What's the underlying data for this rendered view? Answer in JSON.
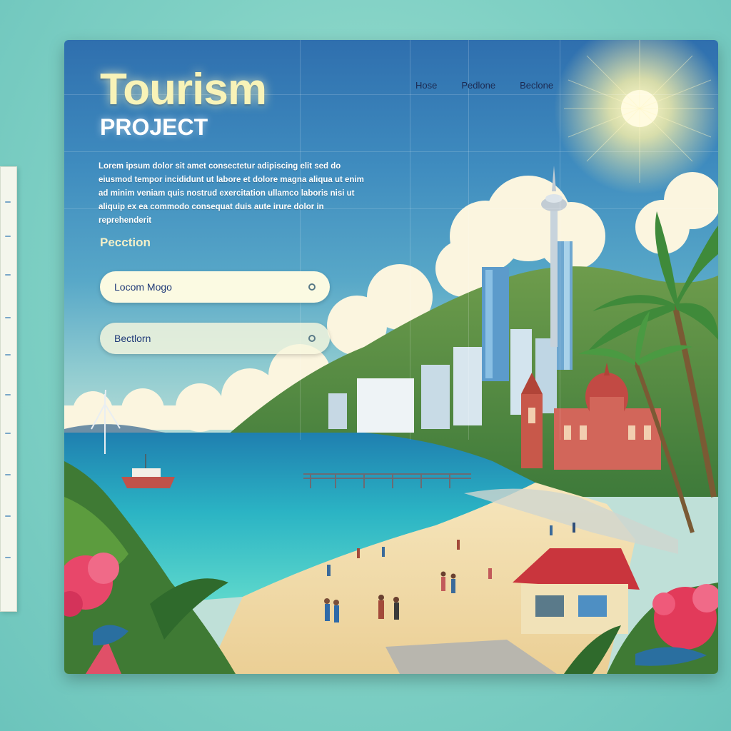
{
  "page": {
    "title": "Tourism",
    "subtitle": "PROJECT",
    "description": "Lorem ipsum dolor sit amet consectetur adipiscing elit sed do eiusmod tempor incididunt ut labore et dolore magna aliqua ut enim ad minim veniam quis nostrud exercitation ullamco laboris nisi ut aliquip ex ea commodo consequat duis aute irure dolor in reprehenderit"
  },
  "nav": {
    "items": [
      {
        "label": "Hose"
      },
      {
        "label": "Pedlone"
      },
      {
        "label": "Beclone"
      }
    ]
  },
  "form": {
    "section_label": "Pecction",
    "fields": [
      {
        "value": "Locom Mogo",
        "icon": "circle-icon"
      },
      {
        "value": "Bectlorn",
        "icon": "circle-icon"
      }
    ]
  },
  "colors": {
    "sky_top": "#2f6fae",
    "sea": "#3cc8c8",
    "sand": "#f3dfae",
    "title_glow": "#f8f3b8",
    "roof_red": "#c23a3a"
  }
}
